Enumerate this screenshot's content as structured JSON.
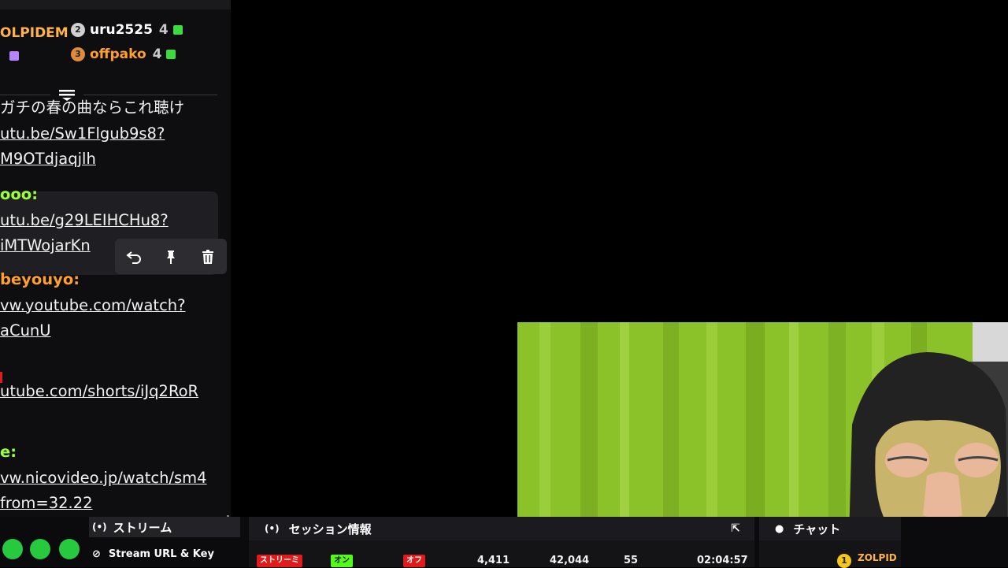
{
  "leaderboard": {
    "top_left_name": "OLPIDEM",
    "entries": [
      {
        "rank": "2",
        "name": "uru2525",
        "count": "4",
        "badge_color": "#cfcfcf",
        "name_color": "#ffffff",
        "gem_color": "#3ddc3d"
      },
      {
        "rank": "3",
        "name": "offpako",
        "count": "4",
        "badge_color": "#e08a3c",
        "name_color": "#ff9f2e",
        "gem_color": "#3ddc3d"
      }
    ]
  },
  "chat_messages": [
    {
      "lines": [
        "ガチの春の曲ならこれ聴け"
      ],
      "links": [
        "utu.be/Sw1Flgub9s8?",
        "M9OTdjaqjlh"
      ]
    },
    {
      "user": "ooo:",
      "user_color": "#9cff3c",
      "links": [
        "utu.be/g29LEIHCHu8?",
        "iMTWojarKn"
      ]
    },
    {
      "user": "beyouyo:",
      "user_color": "#ff9f2e",
      "links": [
        "vw.youtube.com/watch?",
        "aCunU"
      ]
    },
    {
      "links": [
        "utube.com/shorts/iJq2RoR"
      ]
    },
    {
      "user": "e:",
      "user_color": "#9cff3c",
      "links": [
        "vw.nicovideo.jp/watch/sm4",
        "from=32.22"
      ]
    }
  ],
  "message_actions": [
    "reply-icon",
    "pin-icon",
    "delete-icon"
  ],
  "dashboard": {
    "stream_tab": "ストリーム",
    "stream_url_label": "Stream URL & Key",
    "session_title": "セッション情報",
    "chat_title": "チャット",
    "stream_status": "ストリーミ",
    "toggle_on": "オン",
    "toggle_off": "オフ",
    "stat_1": "4,411",
    "stat_2": "42,044",
    "stat_3": "55",
    "uptime": "02:04:57",
    "chat_top_name": "ZOLPID",
    "chat_top_rank": "1"
  },
  "colors": {
    "accent_green": "#53fc18",
    "live_red": "#e01b1b",
    "webcam_curtain": "#8fc42a"
  }
}
